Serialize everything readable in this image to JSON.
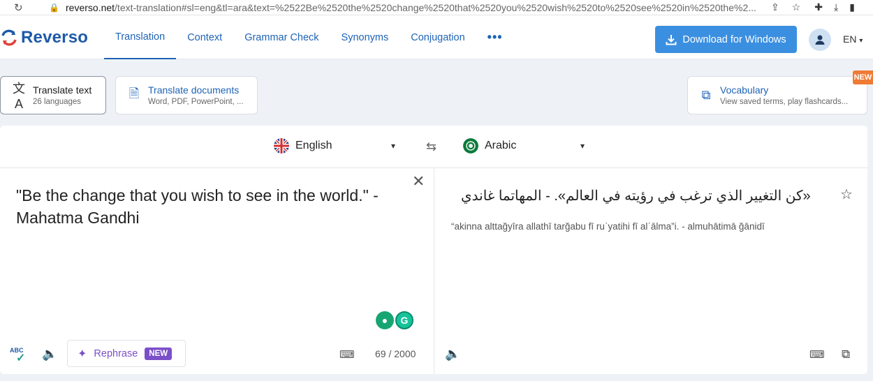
{
  "browser": {
    "url_host": "reverso.net",
    "url_path": "/text-translation#sl=eng&tl=ara&text=%2522Be%2520the%2520change%2520that%2520you%2520wish%2520to%2520see%2520in%2520the%2..."
  },
  "brand": {
    "name": "Reverso",
    "color": "#1e5aa8"
  },
  "nav": {
    "tabs": [
      "Translation",
      "Context",
      "Grammar Check",
      "Synonyms",
      "Conjugation"
    ],
    "more": "•••",
    "download_label": "Download for Windows",
    "lang": "EN"
  },
  "modes": {
    "translate_text": {
      "title": "Translate text",
      "sub": "26 languages"
    },
    "translate_docs": {
      "title": "Translate documents",
      "sub": "Word, PDF, PowerPoint, ..."
    },
    "vocabulary": {
      "title": "Vocabulary",
      "sub": "View saved terms, play flashcards...",
      "badge": "NEW"
    }
  },
  "translator": {
    "source_lang": "English",
    "target_lang": "Arabic",
    "source_text": "\"Be the change that you wish to see in the world.\" - Mahatma Gandhi",
    "target_text": "«كن التغيير الذي ترغب في رؤيته في العالم». - المهاتما غاندي",
    "transliteration": "“akinna alttağyīra allathī tarğabu fī ruʾyatihi fī alʿālma”i. - almuhātimā ğānidī",
    "char_count": "69 / 2000",
    "rephrase_label": "Rephrase",
    "rephrase_badge": "NEW",
    "spell_label": "ABC"
  },
  "colors": {
    "accent": "#3b8fe0",
    "rephrase": "#7b4fc9",
    "new_badge": "#f07b35"
  }
}
